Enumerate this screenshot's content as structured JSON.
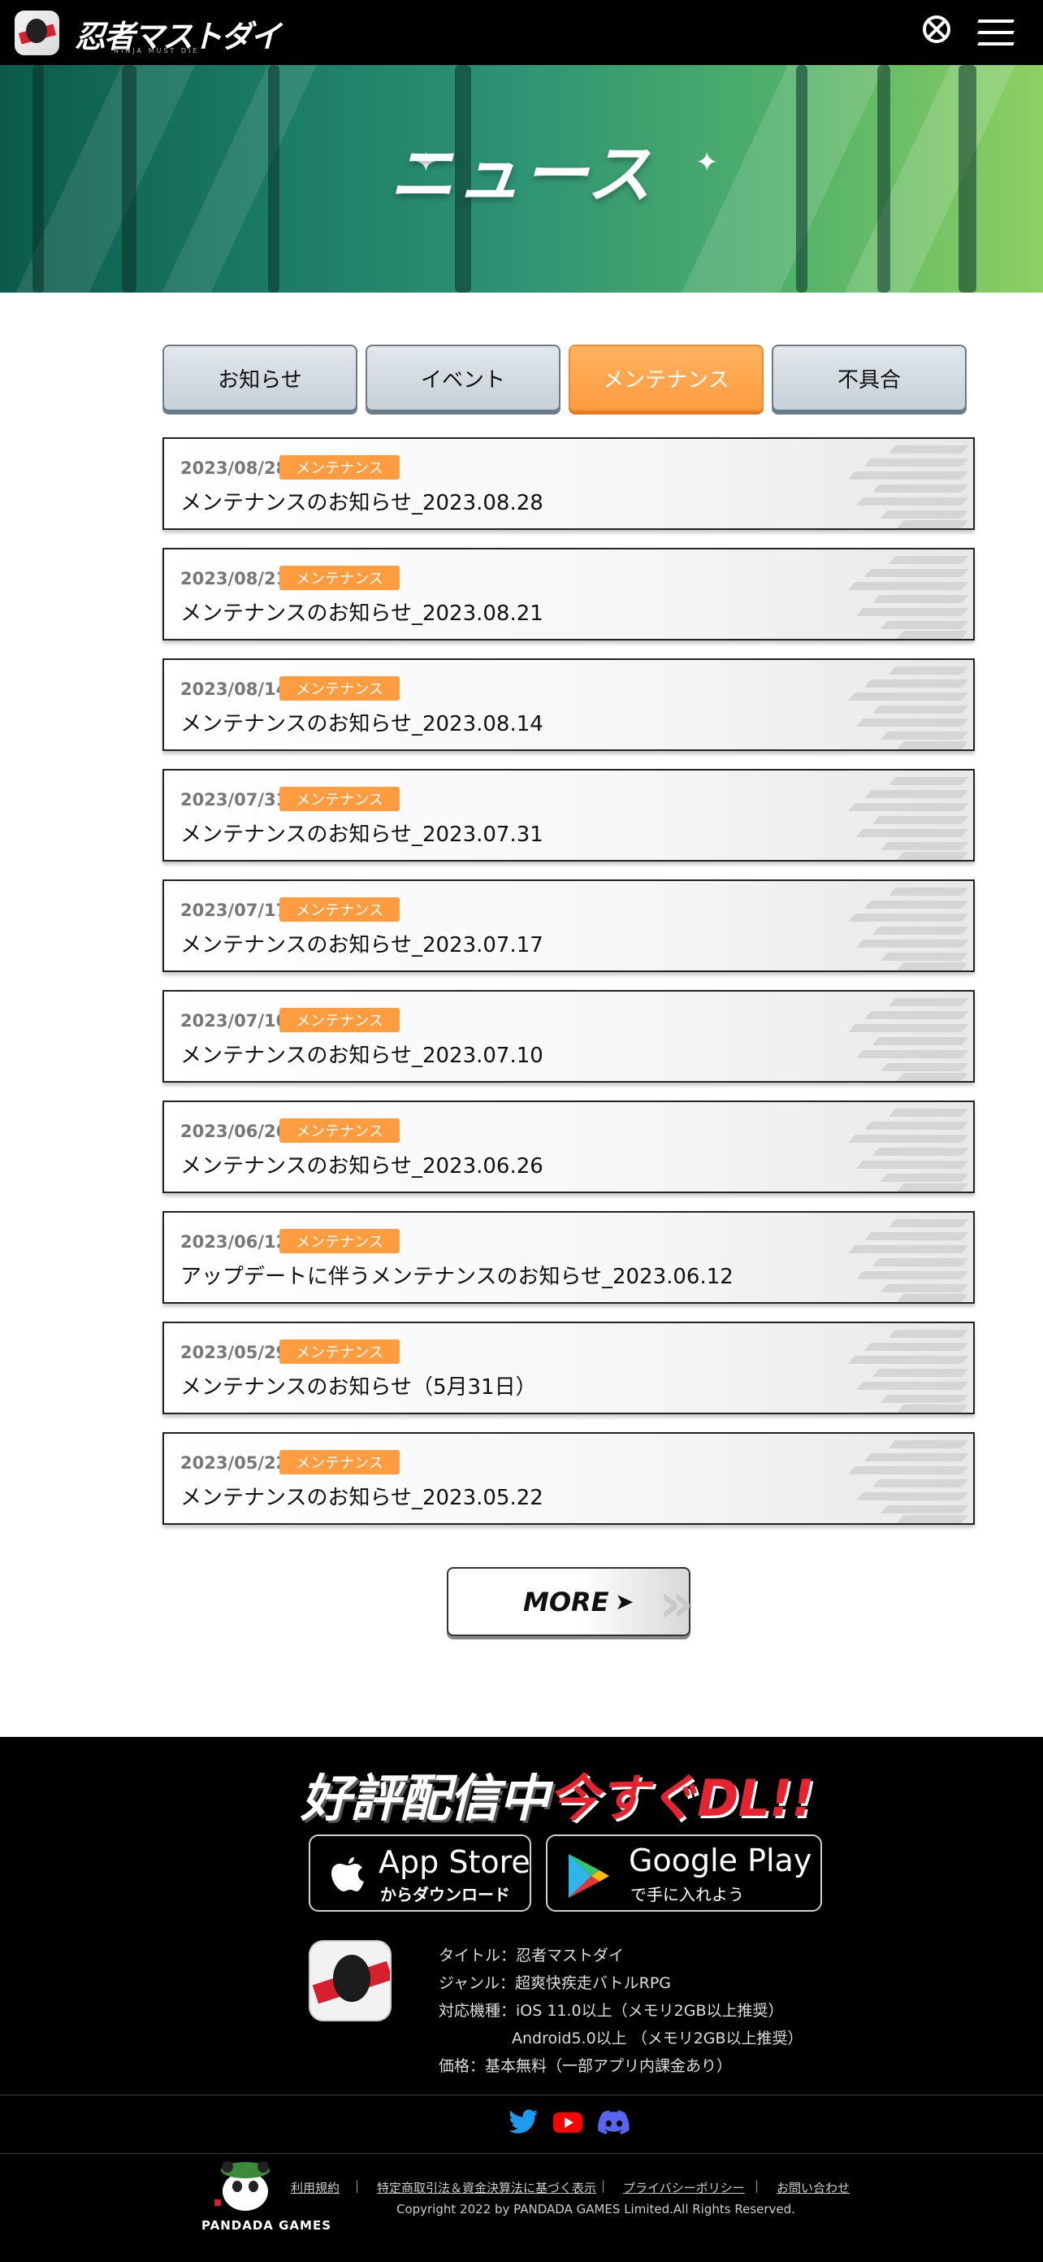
{
  "header": {
    "logo_text": "忍者マストダイ",
    "logo_sub": "NINJA MUST DIE"
  },
  "hero": {
    "title": "ニュース"
  },
  "tabs": [
    {
      "label": "お知らせ",
      "active": false
    },
    {
      "label": "イベント",
      "active": false
    },
    {
      "label": "メンテナンス",
      "active": true
    },
    {
      "label": "不具合",
      "active": false
    }
  ],
  "news": [
    {
      "date": "2023/08/28",
      "badge": "メンテナンス",
      "title": "メンテナンスのお知らせ_2023.08.28"
    },
    {
      "date": "2023/08/21",
      "badge": "メンテナンス",
      "title": "メンテナンスのお知らせ_2023.08.21"
    },
    {
      "date": "2023/08/14",
      "badge": "メンテナンス",
      "title": "メンテナンスのお知らせ_2023.08.14"
    },
    {
      "date": "2023/07/31",
      "badge": "メンテナンス",
      "title": "メンテナンスのお知らせ_2023.07.31"
    },
    {
      "date": "2023/07/17",
      "badge": "メンテナンス",
      "title": "メンテナンスのお知らせ_2023.07.17"
    },
    {
      "date": "2023/07/10",
      "badge": "メンテナンス",
      "title": "メンテナンスのお知らせ_2023.07.10"
    },
    {
      "date": "2023/06/26",
      "badge": "メンテナンス",
      "title": "メンテナンスのお知らせ_2023.06.26"
    },
    {
      "date": "2023/06/12",
      "badge": "メンテナンス",
      "title": "アップデートに伴うメンテナンスのお知らせ_2023.06.12"
    },
    {
      "date": "2023/05/29",
      "badge": "メンテナンス",
      "title": "メンテナンスのお知らせ（5月31日）"
    },
    {
      "date": "2023/05/22",
      "badge": "メンテナンス",
      "title": "メンテナンスのお知らせ_2023.05.22"
    }
  ],
  "more_label": "MORE",
  "footer": {
    "dl_white": "好評配信中",
    "dl_red": "今すぐDL!!",
    "app_store": {
      "big": "App Store",
      "small": "からダウンロード"
    },
    "google_play": {
      "big": "Google Play",
      "small": "で手に入れよう"
    },
    "info": [
      "タイトル：忍者マストダイ",
      "ジャンル：超爽快疾走バトルRPG",
      "対応機種：iOS 11.0以上（メモリ2GB以上推奨）",
      "Android5.0以上 （メモリ2GB以上推奨）",
      "価格：基本無料（一部アプリ内課金あり）"
    ],
    "links": [
      "利用規約",
      "特定商取引法＆資金決算法に基づく表示",
      "プライバシーポリシー",
      "お問い合わせ"
    ],
    "copyright": "Copyright 2022 by PANDADA GAMES Limited.All Rights Reserved.",
    "company": "PANDADA GAMES"
  },
  "colors": {
    "accent": "#ff9c3f",
    "header_bg": "#000000",
    "footer_red": "#e8232f"
  },
  "icons": [
    "logo-icon",
    "steam-icon",
    "menu-icon",
    "apple-icon",
    "google-play-icon",
    "twitter-icon",
    "youtube-icon",
    "discord-icon",
    "panda-logo"
  ]
}
